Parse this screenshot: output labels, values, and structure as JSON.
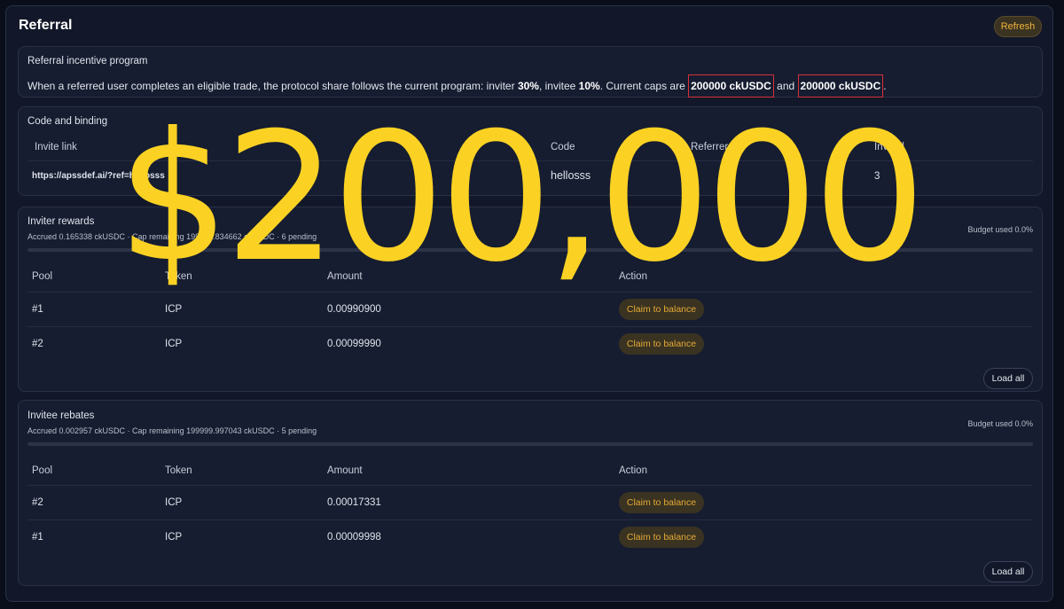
{
  "header": {
    "title": "Referral",
    "refresh_label": "Refresh"
  },
  "incentive": {
    "title": "Referral incentive program",
    "text_before": "When a referred user completes an eligible trade, the protocol share follows the current program: inviter ",
    "inviter_pct": "30%",
    "text_mid1": ", invitee ",
    "invitee_pct": "10%",
    "text_mid2": ". Current caps are ",
    "cap_inviter": "200000 ckUSDC",
    "text_and": " and ",
    "cap_invitee": "200000 ckUSDC",
    "text_end": "."
  },
  "binding": {
    "title": "Code and binding",
    "headers": {
      "invite_link": "Invite link",
      "code": "Code",
      "referrer": "Referrer",
      "invited": "Invited"
    },
    "row": {
      "invite_link": "https://apssdef.ai/?ref=hellosss",
      "code": "hellosss",
      "referrer": "fi",
      "invited": "3"
    }
  },
  "inviter_rewards": {
    "title": "Inviter rewards",
    "summary": "Accrued 0.165338 ckUSDC · Cap remaining 199999.834662 ckUSDC · 6 pending",
    "budget": "Budget used 0.0%",
    "budget_fraction": 0.0,
    "headers": {
      "pool": "Pool",
      "token": "Token",
      "amount": "Amount",
      "action": "Action"
    },
    "rows": [
      {
        "pool": "#1",
        "token": "ICP",
        "amount": "0.00990900",
        "action": "Claim to balance"
      },
      {
        "pool": "#2",
        "token": "ICP",
        "amount": "0.00099990",
        "action": "Claim to balance"
      }
    ],
    "load_all": "Load all"
  },
  "invitee_rebates": {
    "title": "Invitee rebates",
    "summary": "Accrued 0.002957 ckUSDC · Cap remaining 199999.997043 ckUSDC · 5 pending",
    "budget": "Budget used 0.0%",
    "budget_fraction": 0.0,
    "headers": {
      "pool": "Pool",
      "token": "Token",
      "amount": "Amount",
      "action": "Action"
    },
    "rows": [
      {
        "pool": "#2",
        "token": "ICP",
        "amount": "0.00017331",
        "action": "Claim to balance"
      },
      {
        "pool": "#1",
        "token": "ICP",
        "amount": "0.00009998",
        "action": "Claim to balance"
      }
    ],
    "load_all": "Load all"
  },
  "overlay": {
    "text": "$200,000",
    "color": "#fbd223"
  },
  "colors": {
    "accent": "#f0b33a",
    "highlight_box": "#d8303a"
  }
}
